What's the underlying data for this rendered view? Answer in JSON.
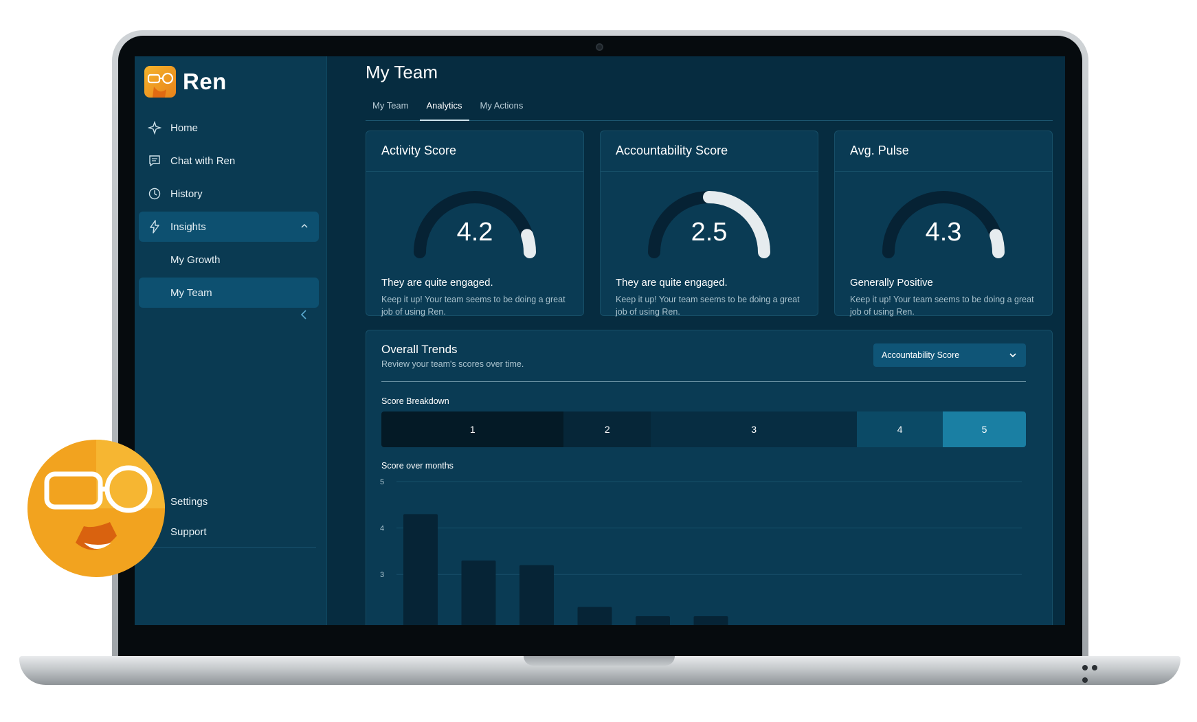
{
  "app": {
    "name": "Ren"
  },
  "sidebar": {
    "items": [
      {
        "label": "Home",
        "icon": "sparkle-icon"
      },
      {
        "label": "Chat with Ren",
        "icon": "chat-icon"
      },
      {
        "label": "History",
        "icon": "history-icon"
      },
      {
        "label": "Insights",
        "icon": "lightning-icon",
        "expanded": true
      }
    ],
    "sub_items": [
      {
        "label": "My Growth",
        "active": false
      },
      {
        "label": "My Team",
        "active": true
      }
    ],
    "bottom_items": [
      {
        "label": "Settings"
      },
      {
        "label": "Support"
      }
    ]
  },
  "page": {
    "title": "My Team",
    "tabs": [
      {
        "label": "My Team",
        "active": false
      },
      {
        "label": "Analytics",
        "active": true
      },
      {
        "label": "My Actions",
        "active": false
      }
    ]
  },
  "cards": [
    {
      "title": "Activity Score",
      "value": "4.2",
      "fraction": 0.84,
      "heading": "They are quite engaged.",
      "description": "Keep it up! Your team seems to be doing a great job of using Ren."
    },
    {
      "title": "Accountability Score",
      "value": "2.5",
      "fraction": 0.5,
      "heading": "They are quite engaged.",
      "description": "Keep it up! Your team seems to be doing a great job of using Ren."
    },
    {
      "title": "Avg. Pulse",
      "value": "4.3",
      "fraction": 0.86,
      "heading": "Generally Positive",
      "description": "Keep it up! Your team seems to be doing a great job of using Ren."
    }
  ],
  "trends": {
    "title": "Overall Trends",
    "subtitle": "Review your team's scores over time.",
    "dropdown_value": "Accountability Score",
    "breakdown_label": "Score Breakdown",
    "breakdown": [
      {
        "label": "1",
        "share": 0.283,
        "color": "#041a26"
      },
      {
        "label": "2",
        "share": 0.135,
        "color": "#062638"
      },
      {
        "label": "3",
        "share": 0.32,
        "color": "#072d42"
      },
      {
        "label": "4",
        "share": 0.133,
        "color": "#0b4a66"
      },
      {
        "label": "5",
        "share": 0.129,
        "color": "#1a7fa3"
      }
    ],
    "months_label": "Score over months"
  },
  "chart_data": {
    "type": "bar",
    "title": "Score over months",
    "yticks": [
      "5",
      "4",
      "3"
    ],
    "ylim": [
      0,
      5
    ],
    "values": [
      4.3,
      3.3,
      3.2,
      2.3,
      2.1,
      2.1
    ],
    "grid": true,
    "bar_color": "#062436"
  },
  "colors": {
    "accent": "#f5b42c",
    "background": "#062c40",
    "sidebar": "#0a3a52",
    "card": "#0a3b54",
    "gauge_track": "#062234",
    "gauge_fill": "#e6ecef"
  }
}
